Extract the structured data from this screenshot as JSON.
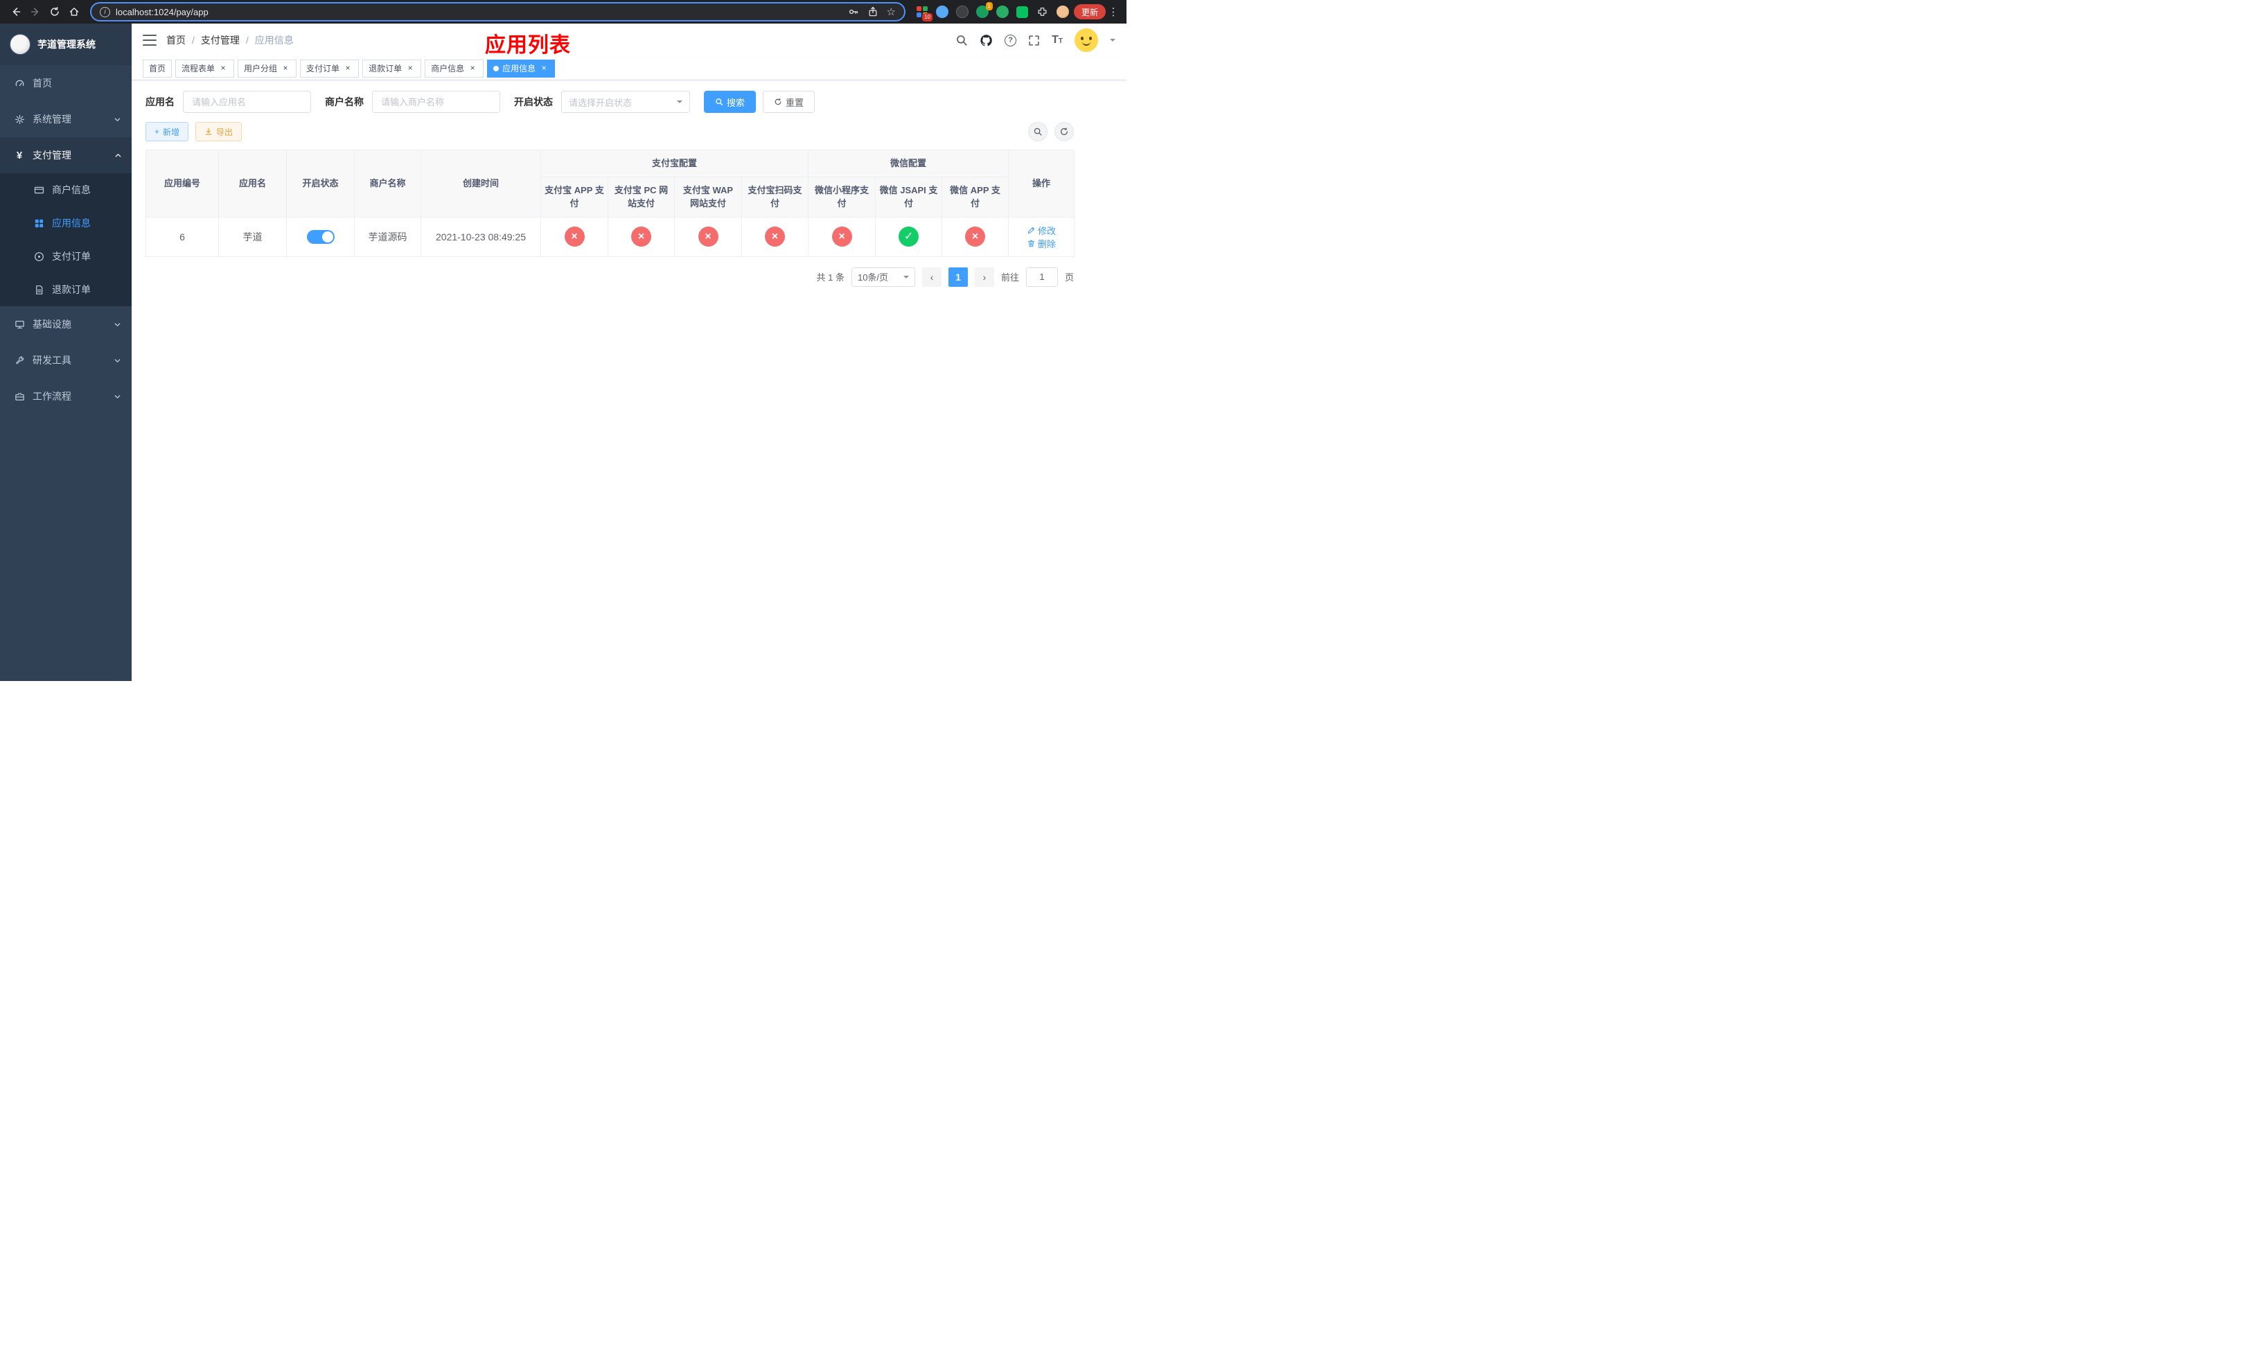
{
  "browser": {
    "url": "localhost:1024/pay/app",
    "update_label": "更新",
    "extension_badges": {
      "grid": "10",
      "leaf": "1"
    }
  },
  "icons": {
    "close": "×",
    "dots": "⋮",
    "star": "☆",
    "yen": "¥",
    "info": "i",
    "question": "?",
    "font_large": "T",
    "font_small": "T",
    "prev": "‹",
    "next": "›",
    "check": "✓",
    "cross": "×"
  },
  "sidebar": {
    "title": "芋道管理系统",
    "menu": [
      {
        "label": "首页"
      },
      {
        "label": "系统管理"
      },
      {
        "label": "支付管理"
      },
      {
        "label": "基础设施"
      },
      {
        "label": "研发工具"
      },
      {
        "label": "工作流程"
      }
    ],
    "payment_submenu": [
      {
        "label": "商户信息"
      },
      {
        "label": "应用信息",
        "active": true
      },
      {
        "label": "支付订单"
      },
      {
        "label": "退款订单"
      }
    ]
  },
  "header": {
    "breadcrumb": [
      "首页",
      "支付管理",
      "应用信息"
    ],
    "separator": "/",
    "annotation": "应用列表"
  },
  "tabs": [
    {
      "label": "首页"
    },
    {
      "label": "流程表单"
    },
    {
      "label": "用户分组"
    },
    {
      "label": "支付订单"
    },
    {
      "label": "退款订单"
    },
    {
      "label": "商户信息"
    },
    {
      "label": "应用信息",
      "active": true
    }
  ],
  "filters": {
    "app_name_label": "应用名",
    "app_name_placeholder": "请输入应用名",
    "merchant_name_label": "商户名称",
    "merchant_name_placeholder": "请输入商户名称",
    "status_label": "开启状态",
    "status_placeholder": "请选择开启状态",
    "search_label": "搜索",
    "reset_label": "重置"
  },
  "toolbar": {
    "add_label": "新增",
    "export_label": "导出"
  },
  "table": {
    "headers": {
      "app_id": "应用编号",
      "app_name": "应用名",
      "status": "开启状态",
      "merchant_name": "商户名称",
      "create_time": "创建时间",
      "alipay_group": "支付宝配置",
      "wechat_group": "微信配置",
      "actions": "操作",
      "alipay_app": "支付宝 APP 支付",
      "alipay_pc": "支付宝 PC 网站支付",
      "alipay_wap": "支付宝 WAP 网站支付",
      "alipay_qr": "支付宝扫码支付",
      "wechat_lite": "微信小程序支付",
      "wechat_jsapi": "微信 JSAPI 支付",
      "wechat_app": "微信 APP 支付"
    },
    "rows": [
      {
        "app_id": "6",
        "app_name": "芋道",
        "status_enabled": true,
        "merchant_name": "芋道源码",
        "create_time": "2021-10-23 08:49:25",
        "channels": [
          "fail",
          "fail",
          "fail",
          "fail",
          "fail",
          "success",
          "fail"
        ],
        "edit_label": "修改",
        "delete_label": "删除"
      }
    ]
  },
  "pagination": {
    "total_text": "共 1 条",
    "page_size": "10条/页",
    "current_page": "1",
    "goto_prefix": "前往",
    "goto_value": "1",
    "goto_suffix": "页"
  },
  "colors": {
    "accent": "#409eff",
    "danger": "#f56c6c",
    "success": "#13ce66",
    "warning": "#e6a23c",
    "annotation": "#ff0000",
    "sidebar_bg": "#304156",
    "submenu_bg": "#1f2d3d"
  }
}
